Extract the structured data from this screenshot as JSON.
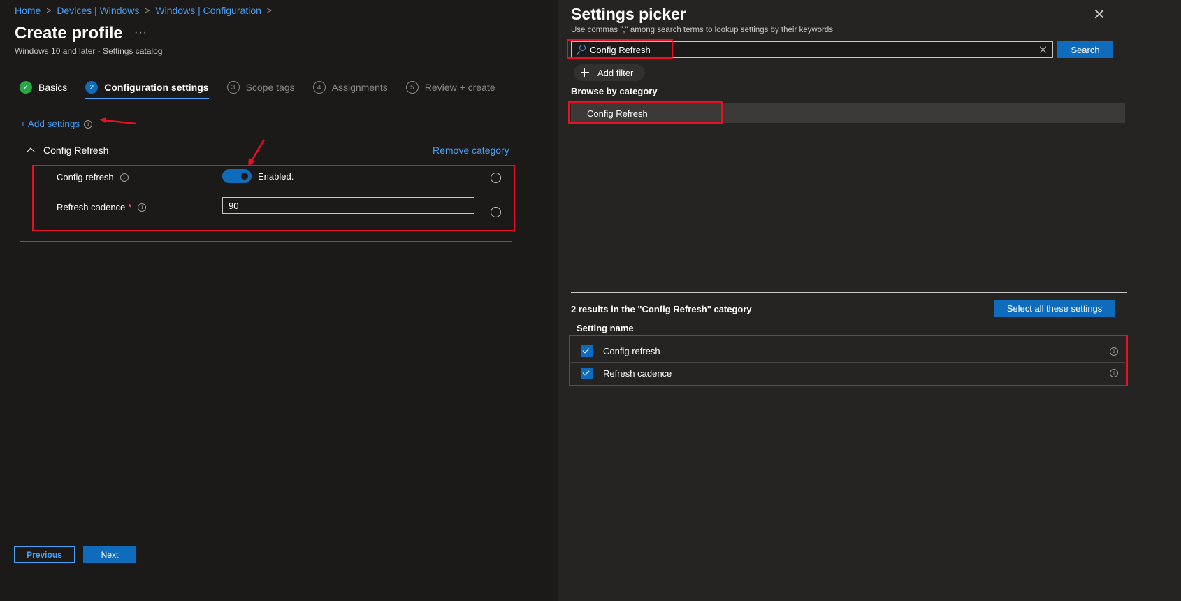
{
  "breadcrumb": [
    "Home",
    "Devices | Windows",
    "Windows | Configuration"
  ],
  "page": {
    "title": "Create profile",
    "more": "···",
    "subtitle": "Windows 10 and later - Settings catalog"
  },
  "steps": [
    {
      "num": "✓",
      "label": "Basics",
      "state": "done"
    },
    {
      "num": "2",
      "label": "Configuration settings",
      "state": "active"
    },
    {
      "num": "3",
      "label": "Scope tags",
      "state": "todo"
    },
    {
      "num": "4",
      "label": "Assignments",
      "state": "todo"
    },
    {
      "num": "5",
      "label": "Review + create",
      "state": "todo"
    }
  ],
  "add_settings_label": "+ Add settings",
  "category": {
    "name": "Config Refresh",
    "remove_label": "Remove category",
    "settings": {
      "config_refresh_label": "Config refresh",
      "toggle_state": "Enabled.",
      "toggle_on": true,
      "refresh_cadence_label": "Refresh cadence",
      "required_marker": "*",
      "refresh_cadence_value": "90"
    }
  },
  "footer": {
    "previous": "Previous",
    "next": "Next"
  },
  "picker": {
    "title": "Settings picker",
    "hint": "Use commas \",\" among search terms to lookup settings by their keywords",
    "search_value": "Config Refresh",
    "search_button": "Search",
    "add_filter": "Add filter",
    "browse_heading": "Browse by category",
    "category_item": "Config Refresh",
    "results_heading": "2 results in the \"Config Refresh\" category",
    "select_all": "Select all these settings",
    "column_header": "Setting name",
    "results": [
      {
        "name": "Config refresh",
        "checked": true
      },
      {
        "name": "Refresh cadence",
        "checked": true
      }
    ]
  },
  "colors": {
    "accent": "#0f6cbd",
    "link": "#479ef5",
    "highlight": "#e81123",
    "success": "#28a745",
    "background": "#1b1a19"
  }
}
